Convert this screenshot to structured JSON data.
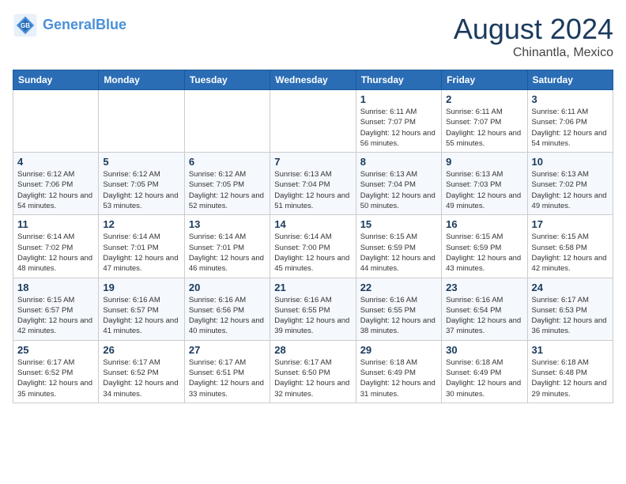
{
  "header": {
    "logo_line1": "General",
    "logo_line2": "Blue",
    "month_year": "August 2024",
    "location": "Chinantla, Mexico"
  },
  "days_of_week": [
    "Sunday",
    "Monday",
    "Tuesday",
    "Wednesday",
    "Thursday",
    "Friday",
    "Saturday"
  ],
  "weeks": [
    [
      {
        "num": "",
        "info": ""
      },
      {
        "num": "",
        "info": ""
      },
      {
        "num": "",
        "info": ""
      },
      {
        "num": "",
        "info": ""
      },
      {
        "num": "1",
        "info": "Sunrise: 6:11 AM\nSunset: 7:07 PM\nDaylight: 12 hours\nand 56 minutes."
      },
      {
        "num": "2",
        "info": "Sunrise: 6:11 AM\nSunset: 7:07 PM\nDaylight: 12 hours\nand 55 minutes."
      },
      {
        "num": "3",
        "info": "Sunrise: 6:11 AM\nSunset: 7:06 PM\nDaylight: 12 hours\nand 54 minutes."
      }
    ],
    [
      {
        "num": "4",
        "info": "Sunrise: 6:12 AM\nSunset: 7:06 PM\nDaylight: 12 hours\nand 54 minutes."
      },
      {
        "num": "5",
        "info": "Sunrise: 6:12 AM\nSunset: 7:05 PM\nDaylight: 12 hours\nand 53 minutes."
      },
      {
        "num": "6",
        "info": "Sunrise: 6:12 AM\nSunset: 7:05 PM\nDaylight: 12 hours\nand 52 minutes."
      },
      {
        "num": "7",
        "info": "Sunrise: 6:13 AM\nSunset: 7:04 PM\nDaylight: 12 hours\nand 51 minutes."
      },
      {
        "num": "8",
        "info": "Sunrise: 6:13 AM\nSunset: 7:04 PM\nDaylight: 12 hours\nand 50 minutes."
      },
      {
        "num": "9",
        "info": "Sunrise: 6:13 AM\nSunset: 7:03 PM\nDaylight: 12 hours\nand 49 minutes."
      },
      {
        "num": "10",
        "info": "Sunrise: 6:13 AM\nSunset: 7:02 PM\nDaylight: 12 hours\nand 49 minutes."
      }
    ],
    [
      {
        "num": "11",
        "info": "Sunrise: 6:14 AM\nSunset: 7:02 PM\nDaylight: 12 hours\nand 48 minutes."
      },
      {
        "num": "12",
        "info": "Sunrise: 6:14 AM\nSunset: 7:01 PM\nDaylight: 12 hours\nand 47 minutes."
      },
      {
        "num": "13",
        "info": "Sunrise: 6:14 AM\nSunset: 7:01 PM\nDaylight: 12 hours\nand 46 minutes."
      },
      {
        "num": "14",
        "info": "Sunrise: 6:14 AM\nSunset: 7:00 PM\nDaylight: 12 hours\nand 45 minutes."
      },
      {
        "num": "15",
        "info": "Sunrise: 6:15 AM\nSunset: 6:59 PM\nDaylight: 12 hours\nand 44 minutes."
      },
      {
        "num": "16",
        "info": "Sunrise: 6:15 AM\nSunset: 6:59 PM\nDaylight: 12 hours\nand 43 minutes."
      },
      {
        "num": "17",
        "info": "Sunrise: 6:15 AM\nSunset: 6:58 PM\nDaylight: 12 hours\nand 42 minutes."
      }
    ],
    [
      {
        "num": "18",
        "info": "Sunrise: 6:15 AM\nSunset: 6:57 PM\nDaylight: 12 hours\nand 42 minutes."
      },
      {
        "num": "19",
        "info": "Sunrise: 6:16 AM\nSunset: 6:57 PM\nDaylight: 12 hours\nand 41 minutes."
      },
      {
        "num": "20",
        "info": "Sunrise: 6:16 AM\nSunset: 6:56 PM\nDaylight: 12 hours\nand 40 minutes."
      },
      {
        "num": "21",
        "info": "Sunrise: 6:16 AM\nSunset: 6:55 PM\nDaylight: 12 hours\nand 39 minutes."
      },
      {
        "num": "22",
        "info": "Sunrise: 6:16 AM\nSunset: 6:55 PM\nDaylight: 12 hours\nand 38 minutes."
      },
      {
        "num": "23",
        "info": "Sunrise: 6:16 AM\nSunset: 6:54 PM\nDaylight: 12 hours\nand 37 minutes."
      },
      {
        "num": "24",
        "info": "Sunrise: 6:17 AM\nSunset: 6:53 PM\nDaylight: 12 hours\nand 36 minutes."
      }
    ],
    [
      {
        "num": "25",
        "info": "Sunrise: 6:17 AM\nSunset: 6:52 PM\nDaylight: 12 hours\nand 35 minutes."
      },
      {
        "num": "26",
        "info": "Sunrise: 6:17 AM\nSunset: 6:52 PM\nDaylight: 12 hours\nand 34 minutes."
      },
      {
        "num": "27",
        "info": "Sunrise: 6:17 AM\nSunset: 6:51 PM\nDaylight: 12 hours\nand 33 minutes."
      },
      {
        "num": "28",
        "info": "Sunrise: 6:17 AM\nSunset: 6:50 PM\nDaylight: 12 hours\nand 32 minutes."
      },
      {
        "num": "29",
        "info": "Sunrise: 6:18 AM\nSunset: 6:49 PM\nDaylight: 12 hours\nand 31 minutes."
      },
      {
        "num": "30",
        "info": "Sunrise: 6:18 AM\nSunset: 6:49 PM\nDaylight: 12 hours\nand 30 minutes."
      },
      {
        "num": "31",
        "info": "Sunrise: 6:18 AM\nSunset: 6:48 PM\nDaylight: 12 hours\nand 29 minutes."
      }
    ]
  ]
}
